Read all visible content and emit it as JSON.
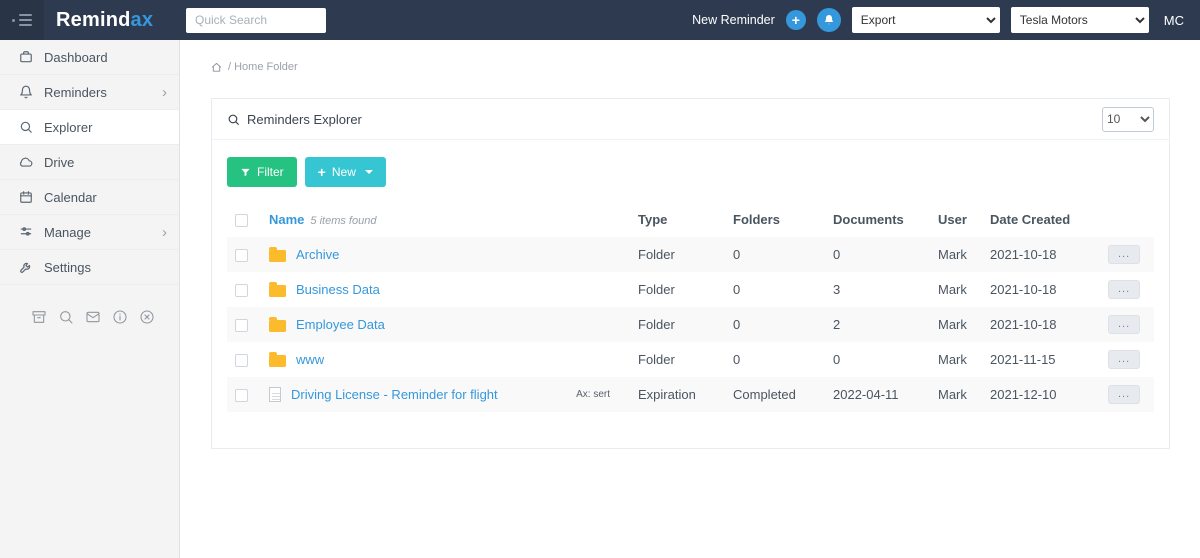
{
  "navbar": {
    "logo_part1": "Remind",
    "logo_part2": "ax",
    "search_placeholder": "Quick Search",
    "new_reminder": "New Reminder",
    "plus": "+",
    "export": "Export",
    "account": "Tesla Motors",
    "user_initials": "MC"
  },
  "sidebar": {
    "items": [
      {
        "label": "Dashboard"
      },
      {
        "label": "Reminders"
      },
      {
        "label": "Explorer"
      },
      {
        "label": "Drive"
      },
      {
        "label": "Calendar"
      },
      {
        "label": "Manage"
      },
      {
        "label": "Settings"
      }
    ],
    "chevron": "›"
  },
  "breadcrumb": {
    "path": "/ Home Folder"
  },
  "explorer": {
    "title": "Reminders Explorer",
    "page_size": "10",
    "filter_label": "Filter",
    "new_label": "New",
    "columns": {
      "name": "Name",
      "items_found": "5 items found",
      "type": "Type",
      "folders": "Folders",
      "documents": "Documents",
      "user": "User",
      "date_created": "Date Created"
    },
    "rows": [
      {
        "name": "Archive",
        "type": "Folder",
        "folders": "0",
        "documents": "0",
        "user": "Mark",
        "date_created": "2021-10-18",
        "actions": "..."
      },
      {
        "name": "Business Data",
        "type": "Folder",
        "folders": "0",
        "documents": "3",
        "user": "Mark",
        "date_created": "2021-10-18",
        "actions": "..."
      },
      {
        "name": "Employee Data",
        "type": "Folder",
        "folders": "0",
        "documents": "2",
        "user": "Mark",
        "date_created": "2021-10-18",
        "actions": "..."
      },
      {
        "name": "www",
        "type": "Folder",
        "folders": "0",
        "documents": "0",
        "user": "Mark",
        "date_created": "2021-11-15",
        "actions": "..."
      },
      {
        "name": "Driving License - Reminder for flight",
        "badge": "Ax: sert",
        "type": "Expiration",
        "folders": "Completed",
        "documents": "2022-04-11",
        "user": "Mark",
        "date_created": "2021-12-10",
        "actions": "..."
      }
    ]
  },
  "colors": {
    "navbar_bg": "#2e3a4f",
    "accent_blue": "#3598dc",
    "filter_green": "#26c281",
    "new_teal": "#36c6d3",
    "folder_yellow": "#fcbb2d",
    "stripe_gray": "#f9f9f9"
  }
}
